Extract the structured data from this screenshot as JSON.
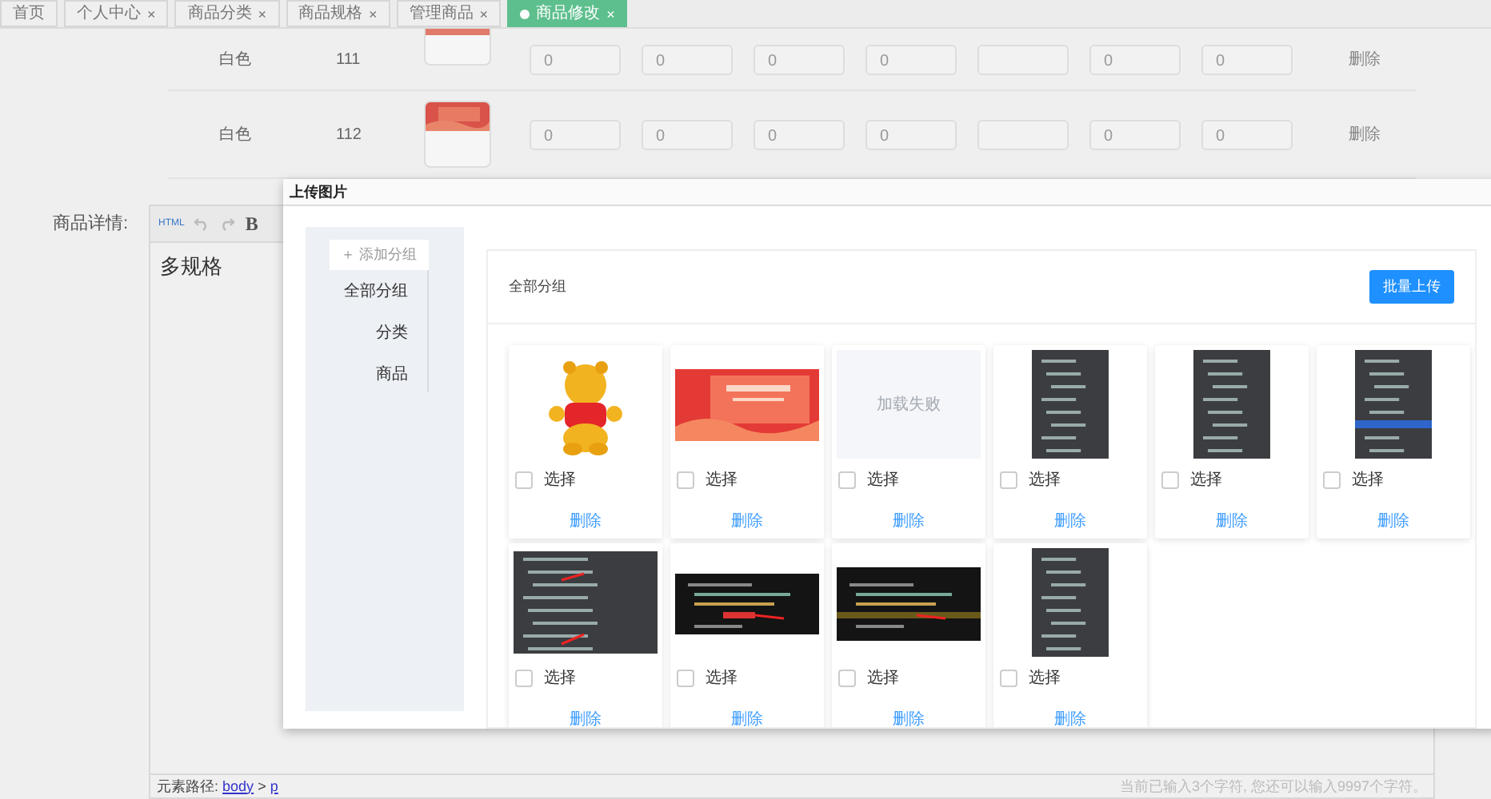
{
  "tabs": [
    {
      "label": "首页",
      "closable": false,
      "selected": false
    },
    {
      "label": "个人中心",
      "closable": true,
      "selected": false
    },
    {
      "label": "商品分类",
      "closable": true,
      "selected": false
    },
    {
      "label": "商品规格",
      "closable": true,
      "selected": false
    },
    {
      "label": "管理商品",
      "closable": true,
      "selected": false
    },
    {
      "label": "商品修改",
      "closable": true,
      "selected": true
    }
  ],
  "close_mark": "×",
  "spec_rows": [
    {
      "spec": "白色",
      "code": "111",
      "inputs": [
        {
          "kind": "text",
          "value": "0"
        },
        {
          "kind": "text",
          "value": "0"
        },
        {
          "kind": "text",
          "value": "0"
        },
        {
          "kind": "text",
          "value": "0"
        },
        {
          "kind": "blank"
        },
        {
          "kind": "text",
          "value": "0"
        },
        {
          "kind": "text",
          "value": "0"
        }
      ],
      "action": "删除"
    },
    {
      "spec": "白色",
      "code": "112",
      "inputs": [
        {
          "kind": "text",
          "value": "0"
        },
        {
          "kind": "text",
          "value": "0"
        },
        {
          "kind": "text",
          "value": "0"
        },
        {
          "kind": "text",
          "value": "0"
        },
        {
          "kind": "blank"
        },
        {
          "kind": "text",
          "value": "0"
        },
        {
          "kind": "text",
          "value": "0"
        }
      ],
      "action": "删除"
    }
  ],
  "editor": {
    "label": "商品详情:",
    "html_label": "HTML",
    "bold_label": "B",
    "content": "多规格",
    "path_label": "元素路径:",
    "path": [
      "body",
      "p"
    ],
    "path_separator": ">",
    "counter": "当前已输入3个字符, 您还可以输入9997个字符。"
  },
  "dialog": {
    "title": "上传图片",
    "add_group": "＋ 添加分组",
    "groups": [
      {
        "label": "全部分组"
      },
      {
        "label": "分类"
      },
      {
        "label": "商品"
      }
    ],
    "header": "全部分组",
    "upload_button": "批量上传",
    "images": [
      {
        "kind": "picture",
        "checked": false,
        "select_label": "选择",
        "delete_label": "删除"
      },
      {
        "kind": "picture",
        "checked": false,
        "select_label": "选择",
        "delete_label": "删除"
      },
      {
        "kind": "failed",
        "text": "加载失败",
        "checked": false,
        "select_label": "选择",
        "delete_label": "删除"
      },
      {
        "kind": "picture",
        "checked": false,
        "select_label": "选择",
        "delete_label": "删除"
      },
      {
        "kind": "picture",
        "checked": false,
        "select_label": "选择",
        "delete_label": "删除"
      },
      {
        "kind": "picture",
        "checked": false,
        "select_label": "选择",
        "delete_label": "删除"
      },
      {
        "kind": "picture",
        "checked": false,
        "select_label": "选择",
        "delete_label": "删除"
      },
      {
        "kind": "picture",
        "checked": false,
        "select_label": "选择",
        "delete_label": "删除"
      },
      {
        "kind": "picture",
        "checked": false,
        "select_label": "选择",
        "delete_label": "删除"
      },
      {
        "kind": "picture",
        "checked": false,
        "select_label": "选择",
        "delete_label": "删除"
      }
    ]
  }
}
